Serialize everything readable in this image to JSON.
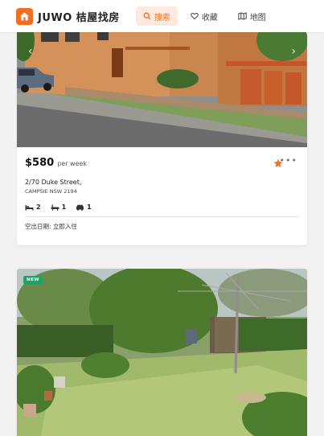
{
  "header": {
    "brand": "JUWO 桔屋找房",
    "nav": [
      {
        "label": "搜索",
        "icon": "search-icon",
        "active": true
      },
      {
        "label": "收藏",
        "icon": "heart-icon",
        "active": false
      },
      {
        "label": "地图",
        "icon": "map-icon",
        "active": false
      }
    ]
  },
  "colors": {
    "accent": "#f26f22",
    "new_badge": "#1aa567"
  },
  "listings": [
    {
      "price": "$580",
      "price_unit": "per week",
      "street": "2/70 Duke Street,",
      "suburb": "CAMPSIE NSW 2194",
      "bedrooms": "2",
      "bathrooms": "1",
      "parking": "1",
      "available": "空出日期: 立即入住",
      "favorited": true
    },
    {
      "badge": "NEW"
    }
  ]
}
